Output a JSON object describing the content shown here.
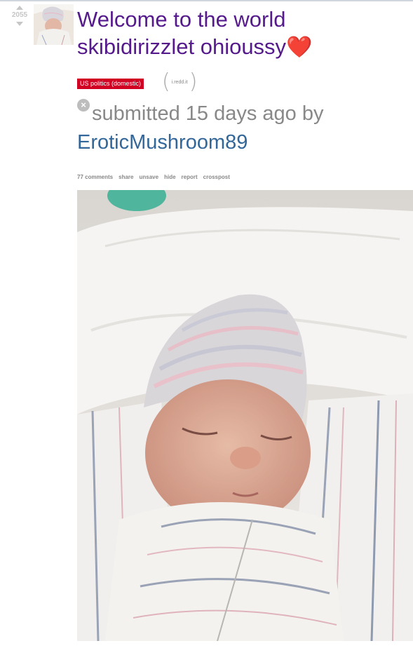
{
  "vote": {
    "score": "2055"
  },
  "post": {
    "title": "Welcome to the world skibidirizzlet ohioussy",
    "title_emoji": "❤️",
    "flair": "US politics (domestic)",
    "domain": "i.redd.it",
    "tagline_prefix": "submitted 15 days ago by",
    "author": "EroticMushroom89"
  },
  "buttons": {
    "comments": "77 comments",
    "share": "share",
    "unsave": "unsave",
    "hide": "hide",
    "report": "report",
    "crosspost": "crosspost"
  },
  "icons": {
    "upvote": "up-arrow-icon",
    "downvote": "down-arrow-icon",
    "remove": "close-circle-icon"
  },
  "colors": {
    "title": "#551a8b",
    "author": "#336699",
    "flair_bg": "#d10023",
    "muted": "#888888"
  }
}
